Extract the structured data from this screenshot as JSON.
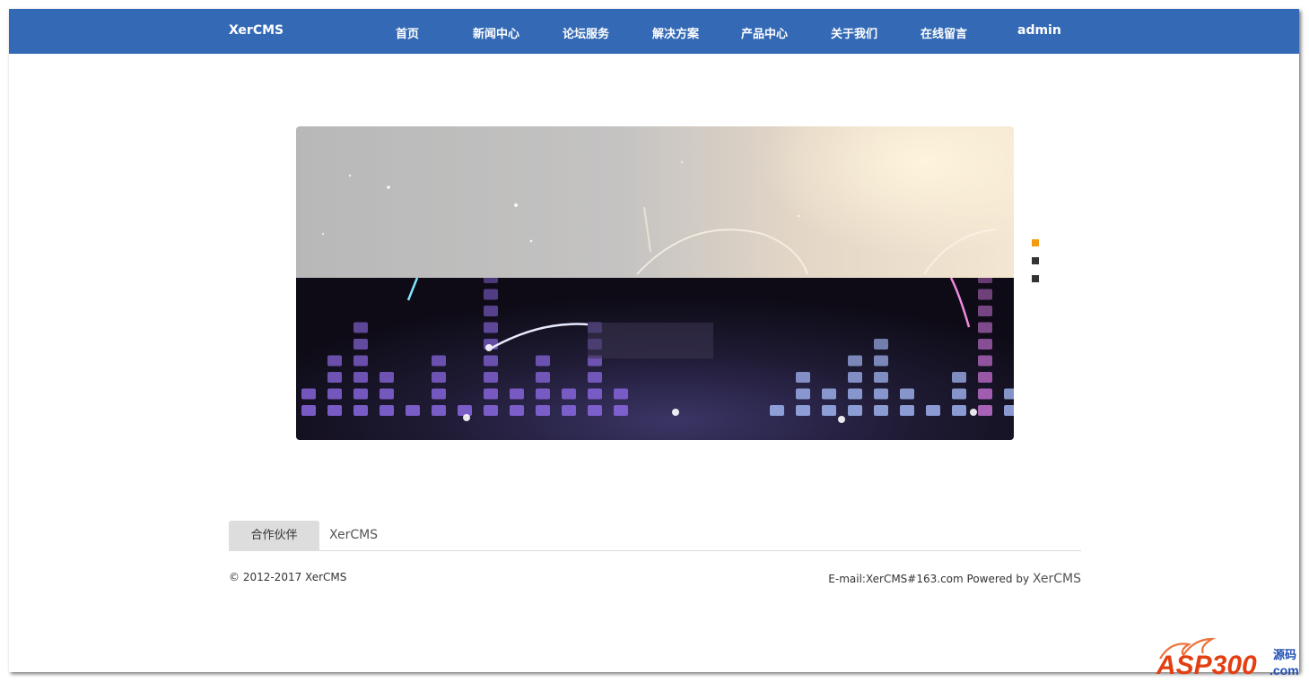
{
  "navbar": {
    "brand": "XerCMS",
    "items": [
      "首页",
      "新闻中心",
      "论坛服务",
      "解决方案",
      "产品中心",
      "关于我们",
      "在线留言",
      "admin"
    ],
    "bg_color": "#346ab5"
  },
  "slider": {
    "dot_count": 3,
    "active_index": 0,
    "active_color": "#f39c12",
    "inactive_color": "#333333"
  },
  "partners": {
    "tab_label": "合作伙伴",
    "links": [
      "XerCMS"
    ]
  },
  "footer": {
    "copyright": "© 2012-2017 XerCMS",
    "email": "E-mail:XerCMS#163.com",
    "powered_by": "Powered by",
    "powered_link": "XerCMS"
  },
  "watermark": {
    "brand": "ASP300",
    "suffix": "源码",
    "domain": ".com"
  }
}
